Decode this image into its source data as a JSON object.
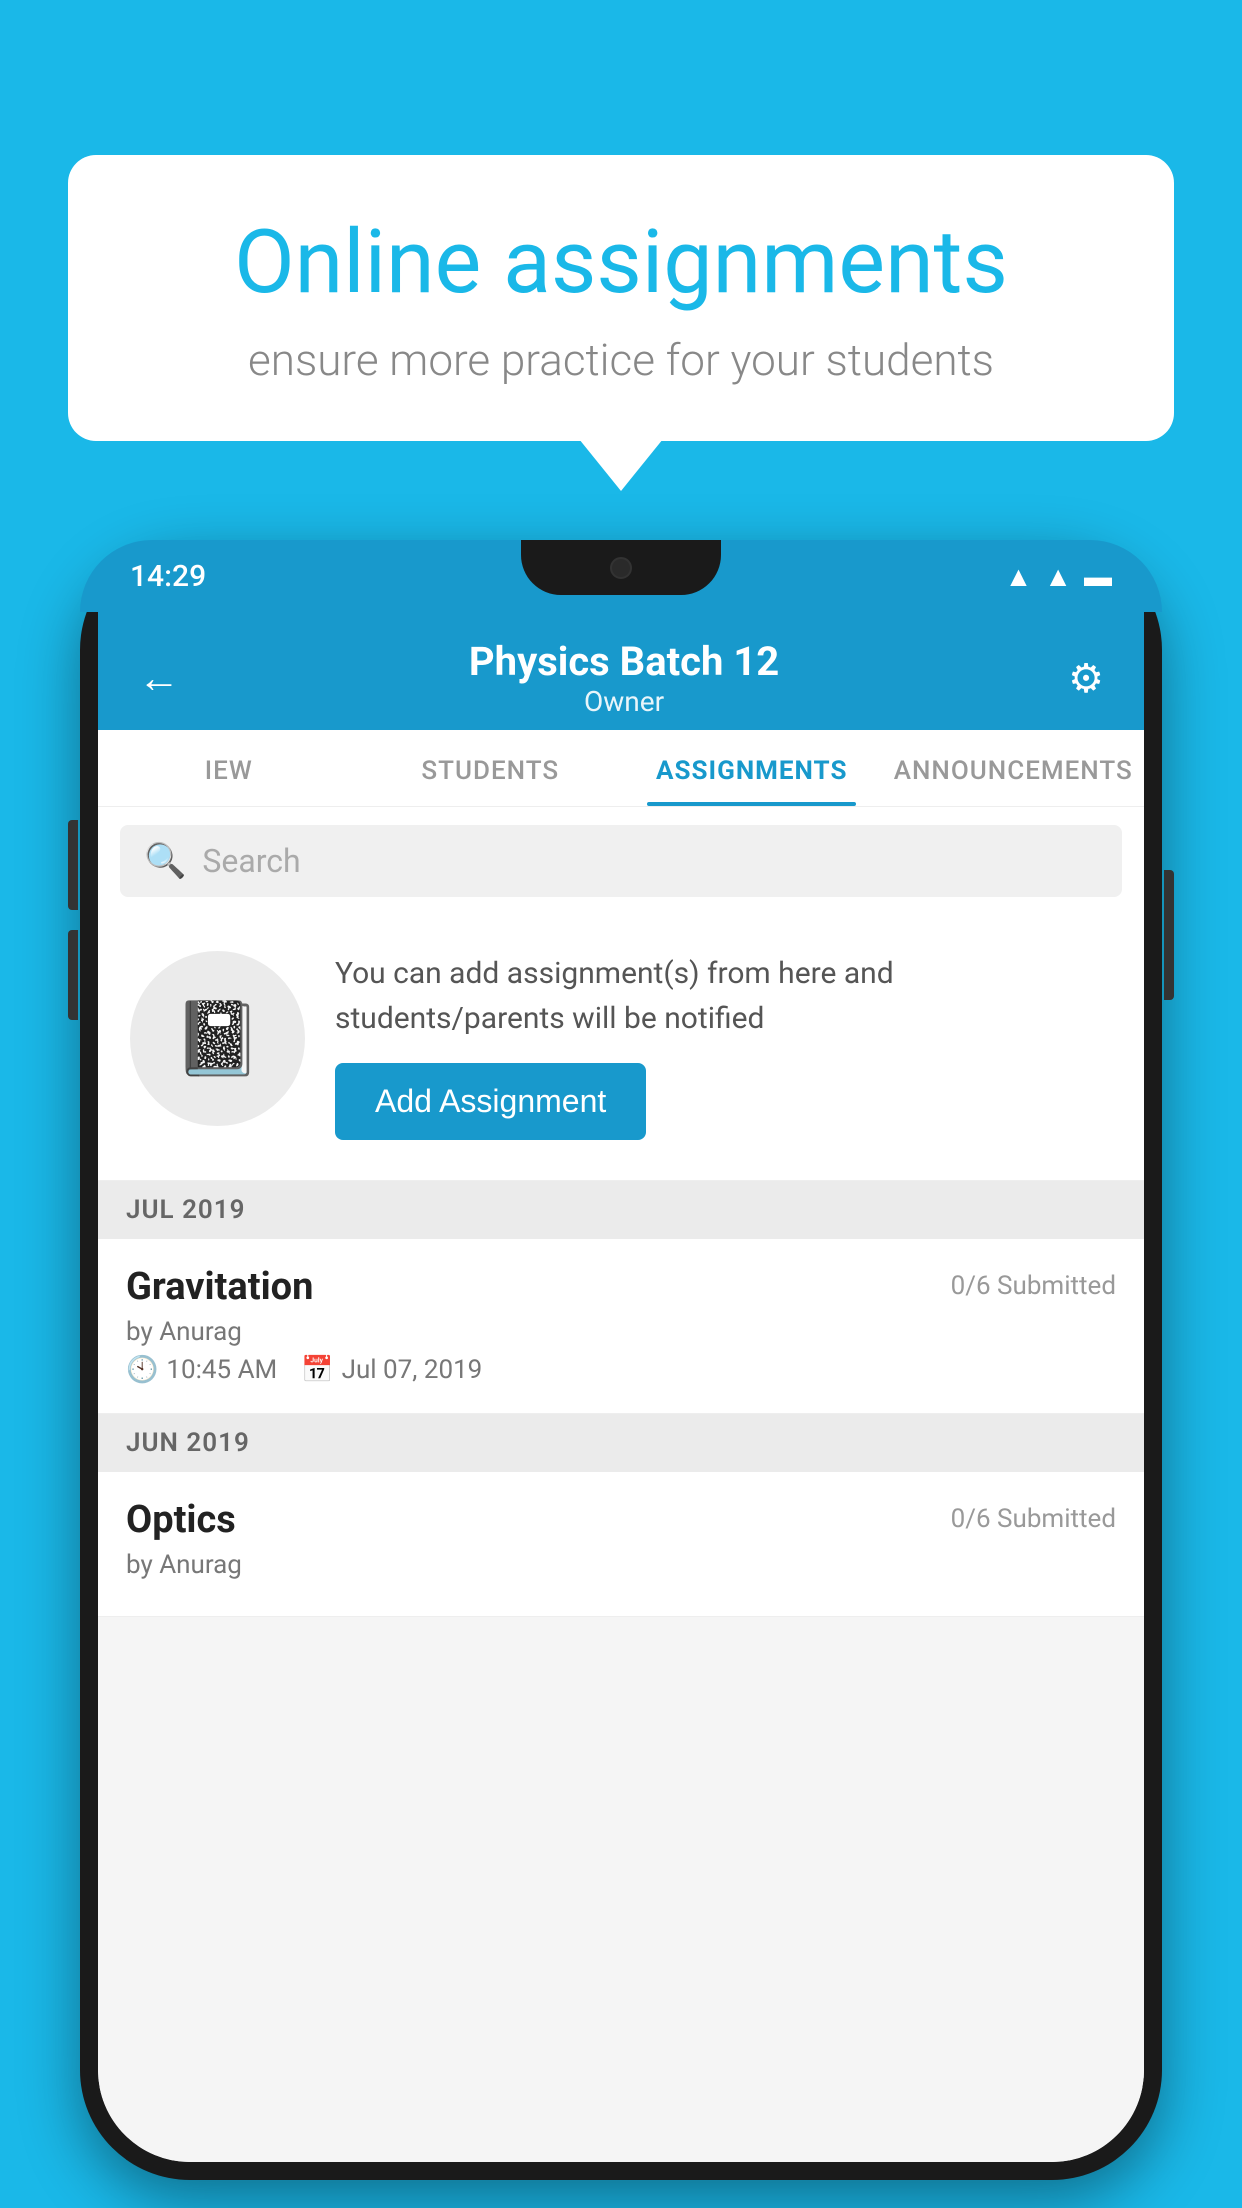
{
  "background_color": "#1ab8e8",
  "speech_bubble": {
    "title": "Online assignments",
    "subtitle": "ensure more practice for your students"
  },
  "phone": {
    "status_bar": {
      "time": "14:29",
      "icons": [
        "wifi",
        "signal",
        "battery"
      ]
    },
    "header": {
      "title": "Physics Batch 12",
      "subtitle": "Owner",
      "back_label": "←",
      "settings_label": "⚙"
    },
    "tabs": [
      {
        "label": "IEW",
        "active": false
      },
      {
        "label": "STUDENTS",
        "active": false
      },
      {
        "label": "ASSIGNMENTS",
        "active": true
      },
      {
        "label": "ANNOUNCEMENTS",
        "active": false
      }
    ],
    "search": {
      "placeholder": "Search"
    },
    "assignment_prompt": {
      "icon": "📓",
      "description": "You can add assignment(s) from here and students/parents will be notified",
      "button_label": "Add Assignment"
    },
    "sections": [
      {
        "month": "JUL 2019",
        "assignments": [
          {
            "name": "Gravitation",
            "submitted": "0/6 Submitted",
            "by": "by Anurag",
            "time": "10:45 AM",
            "date": "Jul 07, 2019"
          }
        ]
      },
      {
        "month": "JUN 2019",
        "assignments": [
          {
            "name": "Optics",
            "submitted": "0/6 Submitted",
            "by": "by Anurag",
            "time": "",
            "date": ""
          }
        ]
      }
    ]
  }
}
